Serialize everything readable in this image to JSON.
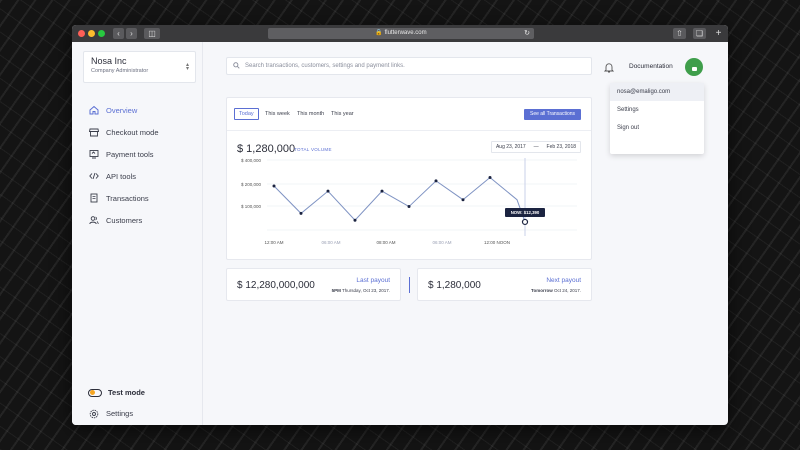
{
  "browser": {
    "url": "flutterwave.com"
  },
  "org": {
    "name": "Nosa Inc",
    "role": "Company Administrator"
  },
  "nav": {
    "items": [
      {
        "label": "Overview",
        "icon": "home-icon"
      },
      {
        "label": "Checkout mode",
        "icon": "storefront-icon"
      },
      {
        "label": "Payment tools",
        "icon": "payment-tools-icon"
      },
      {
        "label": "API tools",
        "icon": "code-icon"
      },
      {
        "label": "Transactions",
        "icon": "document-icon"
      },
      {
        "label": "Customers",
        "icon": "users-icon"
      }
    ],
    "test_mode": "Test mode",
    "settings": "Settings"
  },
  "search": {
    "placeholder": "Search transactions, customers, settings and payment links."
  },
  "header": {
    "documentation": "Documentation"
  },
  "user_menu": {
    "email": "nosa@emaligo.com",
    "settings": "Settings",
    "sign_out": "Sign out"
  },
  "overview": {
    "periods": [
      "Today",
      "This week",
      "This month",
      "This year"
    ],
    "see_all": "See all Transactions",
    "total_amount": "$ 1,280,000",
    "total_label": "TOTAL VOLUME",
    "date_from": "Aug 23, 2017",
    "date_to": "Feb 23, 2018",
    "tooltip": "NOW: $12,390"
  },
  "chart_data": {
    "type": "line",
    "x": [
      "12:00 AM",
      "",
      "06:00 AM",
      "",
      "08:00 AM",
      "",
      "06:00 AM",
      "",
      "12:00 NOON",
      "",
      "NOW"
    ],
    "x_ticks": [
      "12:00 AM",
      "06:00 AM",
      "08:00 AM",
      "06:00 AM",
      "12:00 NOON"
    ],
    "y_ticks": [
      "$ 400,000",
      "$ 200,000",
      "$ 100,000"
    ],
    "values": [
      270,
      110,
      240,
      70,
      240,
      150,
      300,
      190,
      320,
      190,
      60
    ],
    "ylim": [
      0,
      400
    ],
    "grid": true,
    "series_color": "#7f93c3"
  },
  "payouts": {
    "last": {
      "amount": "$ 12,280,000,000",
      "label": "Last payout",
      "time": "5PM",
      "date": "Thursday, Oct 23, 2017."
    },
    "next": {
      "amount": "$ 1,280,000",
      "label": "Next payout",
      "time": "Tomorrow",
      "date": "Oct 24, 2017."
    }
  }
}
